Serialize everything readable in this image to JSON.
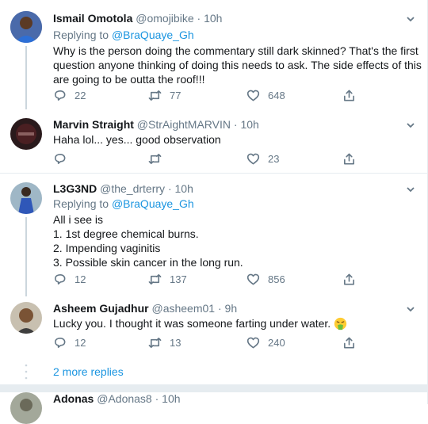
{
  "tweets": [
    {
      "name": "Ismail Omotola",
      "handle": "@omojibike",
      "time": "10h",
      "replying_label": "Replying to",
      "replying_to": "@BraQuaye_Gh",
      "text_lines": [
        "Why is the person doing the commentary still dark skinned? That's the first",
        "question anyone thinking of doing this needs to ask. The side effects of this",
        "are going to be outta the roof!!!"
      ],
      "replies": "22",
      "retweets": "77",
      "likes": "648"
    },
    {
      "name": "Marvin Straight",
      "handle": "@StrAightMARVIN",
      "time": "10h",
      "text_lines": [
        "Haha lol... yes... good observation"
      ],
      "replies": "",
      "retweets": "",
      "likes": "23"
    },
    {
      "name": "L3G3ND",
      "handle": "@the_drterry",
      "time": "10h",
      "replying_label": "Replying to",
      "replying_to": "@BraQuaye_Gh",
      "text_lines": [
        "All i see is",
        "1. 1st degree chemical burns.",
        "2. Impending vaginitis",
        "3. Possible skin cancer in the long run."
      ],
      "replies": "12",
      "retweets": "137",
      "likes": "856"
    },
    {
      "name": "Asheem Gujadhur",
      "handle": "@asheem01",
      "time": "9h",
      "text_lines": [
        "Lucky you. I thought it was someone farting under water."
      ],
      "emoji": "face-vomiting",
      "replies": "12",
      "retweets": "13",
      "likes": "240"
    },
    {
      "name": "Adonas",
      "handle": "@Adonas8",
      "time": "10h"
    }
  ],
  "more_replies": "2 more replies",
  "separator": "·",
  "colors": {
    "link": "#1b95e0",
    "muted": "#657786",
    "text": "#14171a",
    "border": "#e6ecf0"
  },
  "icons": [
    "reply-icon",
    "retweet-icon",
    "like-icon",
    "share-icon",
    "chevron-down-icon",
    "face-vomiting"
  ]
}
